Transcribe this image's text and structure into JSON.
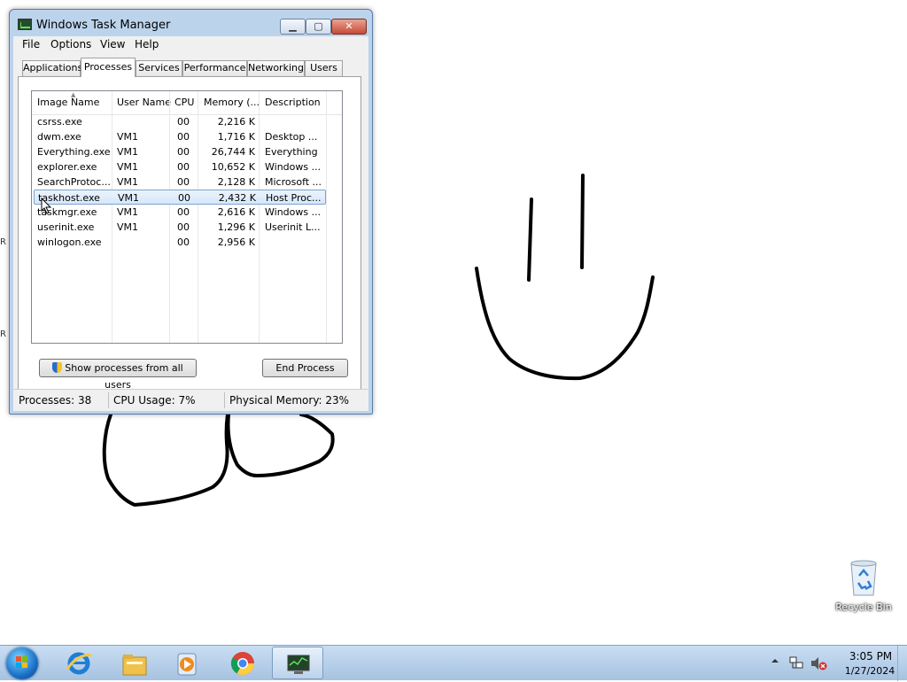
{
  "window": {
    "title": "Windows Task Manager",
    "controls": {
      "minimize": "▁",
      "maximize": "▢",
      "close": "✕"
    }
  },
  "menu": [
    "File",
    "Options",
    "View",
    "Help"
  ],
  "tabs": [
    "Applications",
    "Processes",
    "Services",
    "Performance",
    "Networking",
    "Users"
  ],
  "active_tab": "Processes",
  "columns": [
    "Image Name",
    "User Name",
    "CPU",
    "Memory (...",
    "Description"
  ],
  "processes": [
    {
      "name": "csrss.exe",
      "user": "",
      "cpu": "00",
      "memory": "2,216 K",
      "description": ""
    },
    {
      "name": "dwm.exe",
      "user": "VM1",
      "cpu": "00",
      "memory": "1,716 K",
      "description": "Desktop ..."
    },
    {
      "name": "Everything.exe",
      "user": "VM1",
      "cpu": "00",
      "memory": "26,744 K",
      "description": "Everything"
    },
    {
      "name": "explorer.exe",
      "user": "VM1",
      "cpu": "00",
      "memory": "10,652 K",
      "description": "Windows ..."
    },
    {
      "name": "SearchProtoc...",
      "user": "VM1",
      "cpu": "00",
      "memory": "2,128 K",
      "description": "Microsoft ..."
    },
    {
      "name": "taskhost.exe",
      "user": "VM1",
      "cpu": "00",
      "memory": "2,432 K",
      "description": "Host Proc..."
    },
    {
      "name": "taskmgr.exe",
      "user": "VM1",
      "cpu": "00",
      "memory": "2,616 K",
      "description": "Windows ..."
    },
    {
      "name": "userinit.exe",
      "user": "VM1",
      "cpu": "00",
      "memory": "1,296 K",
      "description": "Userinit L..."
    },
    {
      "name": "winlogon.exe",
      "user": "",
      "cpu": "00",
      "memory": "2,956 K",
      "description": ""
    }
  ],
  "selected_process": "taskhost.exe",
  "buttons": {
    "show_all": "Show processes from all users",
    "end_process": "End Process"
  },
  "status": {
    "processes": "Processes: 38",
    "cpu": "CPU Usage: 7%",
    "memory": "Physical Memory: 23%"
  },
  "desktop": {
    "recycle_bin_label": "Recycle Bin",
    "edge_letters": [
      "R",
      "R"
    ]
  },
  "taskbar": {
    "pinned": [
      "start-orb",
      "internet-explorer-icon",
      "file-explorer-icon",
      "media-player-icon",
      "chrome-icon",
      "task-manager-icon"
    ],
    "active": "task-manager-icon"
  },
  "tray": {
    "time": "3:05 PM",
    "date": "1/27/2024"
  },
  "colors": {
    "selection": "#d6e8fb",
    "taskbar": "#a6c2e0",
    "window_frame": "#bcd3ec"
  }
}
